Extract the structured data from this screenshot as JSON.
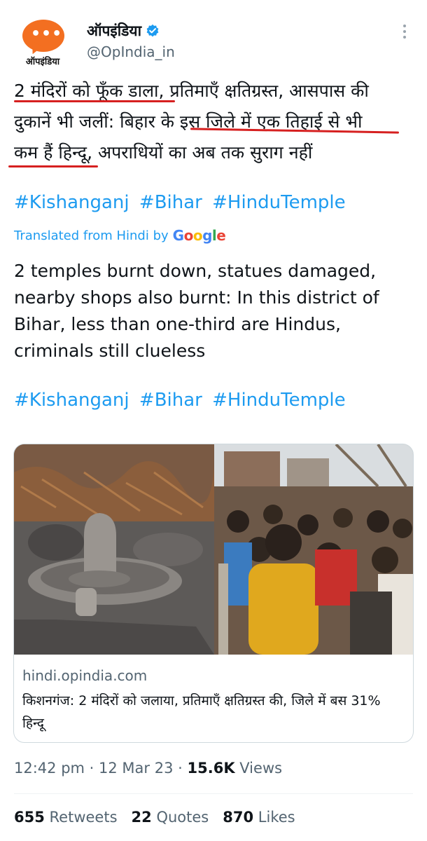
{
  "author": {
    "avatar_text": "ऑपइंडिया",
    "avatar_dots": "•••",
    "display_name": "ऑपइंडिया",
    "handle": "@OpIndia_in",
    "brand_color": "#f36f21",
    "verified_icon": "verified-badge-icon"
  },
  "tweet": {
    "hindi_line1": "2 मंदिरों को फूँक डाला, प्रतिमाएँ क्षतिग्रस्त, आसपास की",
    "hindi_line2": "दुकानें भी जलीं: बिहार के इस जिले में एक तिहाई से भी",
    "hindi_line3": "कम हैं हिन्दू, अपराधियों का अब तक सुराग नहीं",
    "hashtags": [
      "#Kishanganj",
      "#Bihar",
      "#HinduTemple"
    ],
    "translated_label": "Translated from Hindi by",
    "translator": "Google",
    "english_text": "2 temples burnt down, statues damaged, nearby shops also burnt: In this district of Bihar, less than one-third are Hindus, criminals still clueless",
    "underline_color": "#d62020",
    "link_color": "#1d9bf0"
  },
  "card": {
    "domain": "hindi.opindia.com",
    "title": "किशनगंज: 2 मंदिरों को जलाया, प्रतिमाएँ क्षतिग्रस्त की, जिले में बस 31% हिन्दू"
  },
  "meta": {
    "time": "12:42 pm",
    "date": "12 Mar 23",
    "views_count": "15.6K",
    "views_label": "Views"
  },
  "stats": {
    "retweets_count": "655",
    "retweets_label": "Retweets",
    "quotes_count": "22",
    "quotes_label": "Quotes",
    "likes_count": "870",
    "likes_label": "Likes"
  }
}
